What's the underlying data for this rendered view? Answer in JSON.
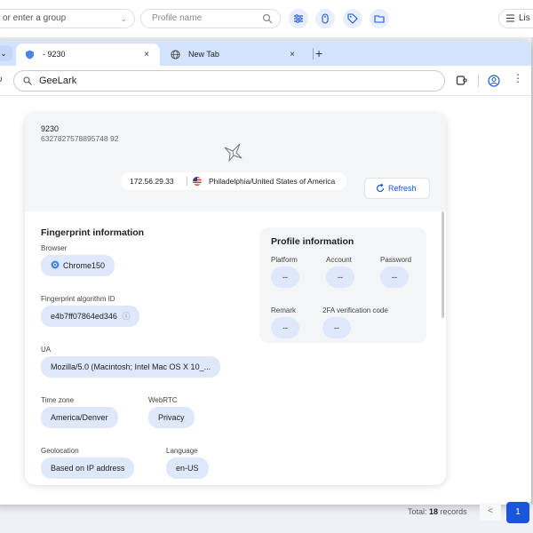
{
  "toolbar": {
    "group_placeholder": "or enter a group",
    "profile_placeholder": "Profile name",
    "list_label": "Lis"
  },
  "browser": {
    "tabs": [
      {
        "title": "- 9230",
        "close": "×"
      },
      {
        "title": "New Tab",
        "close": "×"
      }
    ],
    "new_tab": "+",
    "address": "GeeLark"
  },
  "profile": {
    "name": "9230",
    "id": "6327827578895748 92",
    "ip": "172.56.29.33",
    "location": "Philadelphia/United States of America",
    "refresh_label": "Refresh"
  },
  "fingerprint": {
    "title": "Fingerprint information",
    "browser_label": "Browser",
    "browser_value": "Chrome150",
    "algo_label": "Fingerprint algorithm ID",
    "algo_value": "e4b7ff07864ed346",
    "ua_label": "UA",
    "ua_value": "Mozilla/5.0 (Macintosh; Intel Mac OS X 10_...",
    "timezone_label": "Time zone",
    "timezone_value": "America/Denver",
    "webrtc_label": "WebRTC",
    "webrtc_value": "Privacy",
    "geo_label": "Geolocation",
    "geo_value": "Based on IP address",
    "language_label": "Language",
    "language_value": "en-US"
  },
  "profile_info": {
    "title": "Profile information",
    "platform_label": "Platform",
    "platform_value": "--",
    "account_label": "Account",
    "account_value": "--",
    "password_label": "Password",
    "password_value": "--",
    "remark_label": "Remark",
    "remark_value": "--",
    "twofa_label": "2FA verification code",
    "twofa_value": "--"
  },
  "footer": {
    "total_prefix": "Total:",
    "total_count": "18",
    "total_suffix": "records",
    "prev": "<",
    "page": "1"
  },
  "colors": {
    "accent": "#1a56db",
    "chip": "#dfe8fb",
    "tabstrip": "#d3e3fd"
  }
}
